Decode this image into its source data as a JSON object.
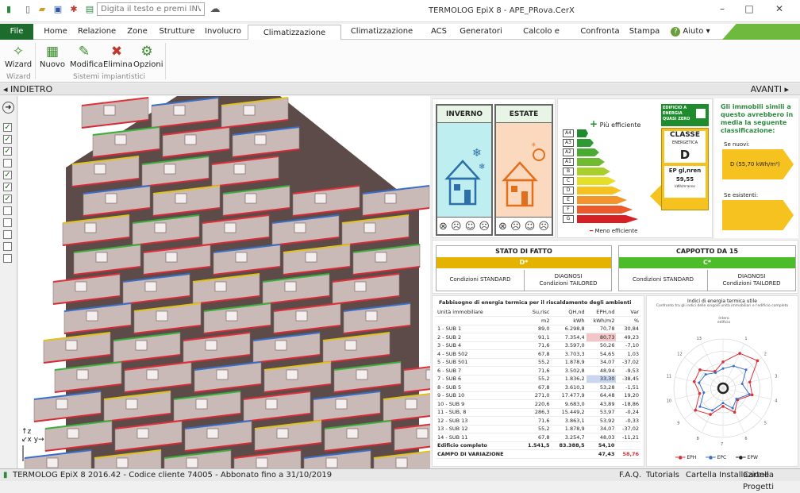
{
  "app": {
    "title": "TERMOLOG EpiX 8 - APE_PRova.CerX",
    "search_placeholder": "Digita il testo e premi INVIO"
  },
  "tabs": [
    "File",
    "Home",
    "Relazione",
    "Zone",
    "Strutture",
    "Involucro",
    "Climatizzazione invernale",
    "Climatizzazione estiva",
    "ACS",
    "Generatori",
    "Calcolo e diagnosi",
    "Confronta",
    "Stampa",
    "Aiuto"
  ],
  "ribbon": {
    "wizard": {
      "label": "Wizard",
      "group": "Wizard"
    },
    "nuovo": "Nuovo",
    "modifica": "Modifica",
    "elimina": "Elimina",
    "opzioni": "Opzioni",
    "group_label": "Sistemi impiantistici"
  },
  "nav": {
    "back": "INDIETRO",
    "forward": "AVANTI"
  },
  "checkboxes": [
    true,
    true,
    true,
    false,
    true,
    true,
    true,
    false,
    false,
    false,
    false,
    false
  ],
  "season": {
    "winter": "INVERNO",
    "summer": "ESTATE"
  },
  "energy": {
    "top_label": "Più efficiente",
    "bottom_label": "Meno efficiente",
    "classes": [
      "A4",
      "A3",
      "A2",
      "A1",
      "B",
      "C",
      "D",
      "E",
      "F",
      "G"
    ],
    "colors": [
      "#1e8c2d",
      "#2f9a33",
      "#4aab33",
      "#6fbc30",
      "#a8cf2c",
      "#e5df2a",
      "#f6c21f",
      "#f3952a",
      "#ea5a2a",
      "#d71f26"
    ],
    "nzeb": "EDIFICIO A ENERGIA QUASI ZERO",
    "classe_title": "CLASSE",
    "classe_sub": "ENERGETICA",
    "classe": "D",
    "ep_label": "EP gl,nren",
    "ep_value": "59,55",
    "ep_unit": "kWh/m²anno"
  },
  "similar": {
    "title": "Gli immobili simili a questo avrebbero in media la seguente classificazione:",
    "new_label": "Se nuovi:",
    "new_value": "D (55,70 kWh/m²)",
    "existing_label": "Se esistenti:"
  },
  "state": {
    "stato_title": "STATO DI FATTO",
    "stato_class": "D*",
    "cappotto_title": "CAPPOTTO DA 15",
    "cappotto_class": "C*",
    "std": "Condizioni STANDARD",
    "diag_1": "DIAGNOSI",
    "diag_2": "Condizioni TAILORED"
  },
  "table": {
    "title": "Fabbisogno di energia termica per il riscaldamento degli ambienti",
    "headers": [
      "Unità immobiliare",
      "Su,risc",
      "QH,nd",
      "EPH,nd",
      "Var"
    ],
    "units": [
      "",
      "m2",
      "kWh",
      "kWh/m2",
      "%"
    ],
    "rows": [
      [
        "1 - SUB 1",
        "89,0",
        "6.298,8",
        "70,78",
        "30,84"
      ],
      [
        "2 - SUB 2",
        "91,1",
        "7.354,4",
        "80,73",
        "49,23"
      ],
      [
        "3 - SUB 4",
        "71,6",
        "3.597,0",
        "50,26",
        "-7,10"
      ],
      [
        "4 - SUB 502",
        "67,8",
        "3.703,3",
        "54,65",
        "1,03"
      ],
      [
        "5 - SUB 501",
        "55,2",
        "1.878,9",
        "34,07",
        "-37,02"
      ],
      [
        "6 - SUB 7",
        "71,6",
        "3.502,8",
        "48,94",
        "-9,53"
      ],
      [
        "7 - SUB 6",
        "55,2",
        "1.836,2",
        "33,30",
        "-38,45"
      ],
      [
        "8 - SUB 5",
        "67,8",
        "3.610,3",
        "53,28",
        "-1,51"
      ],
      [
        "9 - SUB 10",
        "271,0",
        "17.477,9",
        "64,48",
        "19,20"
      ],
      [
        "10 - SUB 9",
        "220,6",
        "9.683,0",
        "43,89",
        "-18,86"
      ],
      [
        "11 - SUB, 8",
        "286,3",
        "15.449,2",
        "53,97",
        "-0,24"
      ],
      [
        "12 - SUB 13",
        "71,6",
        "3.863,1",
        "53,92",
        "-0,33"
      ],
      [
        "13 - SUB 12",
        "55,2",
        "1.878,9",
        "34,07",
        "-37,02"
      ],
      [
        "14 - SUB 11",
        "67,8",
        "3.254,7",
        "48,03",
        "-11,21"
      ]
    ],
    "total": [
      "Edificio completo",
      "1.541,5",
      "83.388,5",
      "54,10",
      ""
    ],
    "variation": [
      "CAMPO DI VARIAZIONE",
      "",
      "",
      "47,43",
      "58,76"
    ]
  },
  "radar": {
    "title": "Indici di energia termica utile",
    "subtitle": "Confronto tra gli indici delle singole unità immobiliari e l'edificio completo",
    "center_label": "Intero edificio",
    "legend": [
      "EPH",
      "EPC",
      "EPW"
    ],
    "colors": [
      "#d9303a",
      "#3a6fc9",
      "#222222"
    ]
  },
  "status": {
    "left": "TERMOLOG EpiX 8 2016.42 - Codice cliente 74005 - Abbonato fino a 31/10/2019",
    "faq": "F.A.Q.",
    "tutorials": "Tutorials",
    "installazione": "Cartella Installazione",
    "progetti": "Cartella Progetti"
  }
}
